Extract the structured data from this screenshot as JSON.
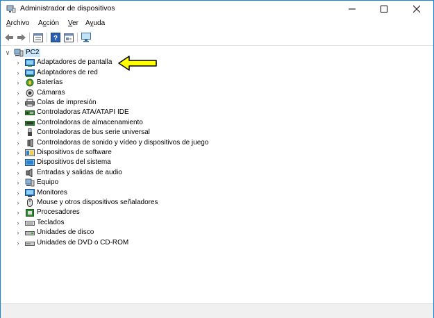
{
  "window": {
    "title": "Administrador de dispositivos",
    "minimize_label": "–",
    "maximize_label": "☐",
    "close_label": "✕"
  },
  "menu": {
    "items": [
      {
        "label": "Archivo",
        "accel": "A",
        "rest": "rchivo"
      },
      {
        "label": "Acción",
        "accel": "c",
        "pre": "A",
        "rest": "ción"
      },
      {
        "label": "Ver",
        "accel": "V",
        "rest": "er"
      },
      {
        "label": "Ayuda",
        "accel": "y",
        "pre": "A",
        "rest": "uda"
      }
    ]
  },
  "toolbar": {
    "icons": [
      "back-icon",
      "forward-icon",
      "properties-icon",
      "help-icon",
      "view-icon",
      "monitor-icon"
    ]
  },
  "tree": {
    "root": {
      "label": "PC2",
      "icon": "computer-icon"
    },
    "items": [
      {
        "label": "Adaptadores de pantalla",
        "icon": "display-adapter-icon"
      },
      {
        "label": "Adaptadores de red",
        "icon": "network-adapter-icon"
      },
      {
        "label": "Baterías",
        "icon": "battery-icon"
      },
      {
        "label": "Cámaras",
        "icon": "camera-icon"
      },
      {
        "label": "Colas de impresión",
        "icon": "printer-icon"
      },
      {
        "label": "Controladoras ATA/ATAPI IDE",
        "icon": "ide-controller-icon"
      },
      {
        "label": "Controladoras de almacenamiento",
        "icon": "storage-controller-icon"
      },
      {
        "label": "Controladoras de bus serie universal",
        "icon": "usb-icon"
      },
      {
        "label": "Controladoras de sonido y vídeo y dispositivos de juego",
        "icon": "sound-icon"
      },
      {
        "label": "Dispositivos de software",
        "icon": "software-device-icon"
      },
      {
        "label": "Dispositivos del sistema",
        "icon": "system-device-icon"
      },
      {
        "label": "Entradas y salidas de audio",
        "icon": "audio-io-icon"
      },
      {
        "label": "Equipo",
        "icon": "computer-icon"
      },
      {
        "label": "Monitores",
        "icon": "monitor-icon"
      },
      {
        "label": "Mouse y otros dispositivos señaladores",
        "icon": "mouse-icon"
      },
      {
        "label": "Procesadores",
        "icon": "processor-icon"
      },
      {
        "label": "Teclados",
        "icon": "keyboard-icon"
      },
      {
        "label": "Unidades de disco",
        "icon": "disk-drive-icon"
      },
      {
        "label": "Unidades de DVD o CD-ROM",
        "icon": "dvd-drive-icon"
      }
    ]
  },
  "annotation": {
    "icon": "yellow-arrow-icon",
    "color": "#ffff00"
  }
}
